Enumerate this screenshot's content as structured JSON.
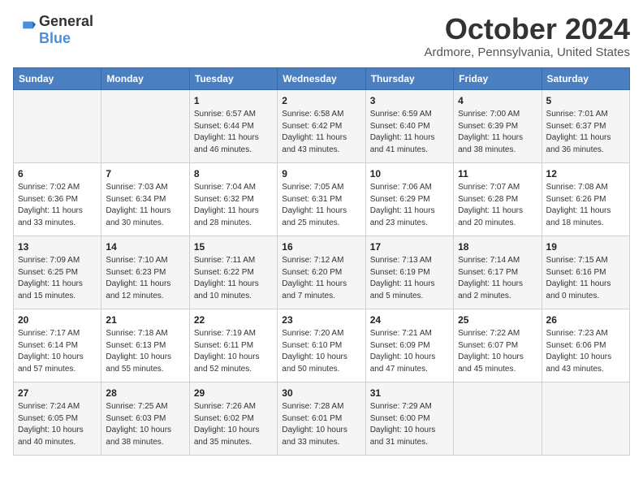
{
  "logo": {
    "general": "General",
    "blue": "Blue"
  },
  "header": {
    "month": "October 2024",
    "location": "Ardmore, Pennsylvania, United States"
  },
  "weekdays": [
    "Sunday",
    "Monday",
    "Tuesday",
    "Wednesday",
    "Thursday",
    "Friday",
    "Saturday"
  ],
  "weeks": [
    [
      {
        "day": "",
        "info": ""
      },
      {
        "day": "",
        "info": ""
      },
      {
        "day": "1",
        "info": "Sunrise: 6:57 AM\nSunset: 6:44 PM\nDaylight: 11 hours and 46 minutes."
      },
      {
        "day": "2",
        "info": "Sunrise: 6:58 AM\nSunset: 6:42 PM\nDaylight: 11 hours and 43 minutes."
      },
      {
        "day": "3",
        "info": "Sunrise: 6:59 AM\nSunset: 6:40 PM\nDaylight: 11 hours and 41 minutes."
      },
      {
        "day": "4",
        "info": "Sunrise: 7:00 AM\nSunset: 6:39 PM\nDaylight: 11 hours and 38 minutes."
      },
      {
        "day": "5",
        "info": "Sunrise: 7:01 AM\nSunset: 6:37 PM\nDaylight: 11 hours and 36 minutes."
      }
    ],
    [
      {
        "day": "6",
        "info": "Sunrise: 7:02 AM\nSunset: 6:36 PM\nDaylight: 11 hours and 33 minutes."
      },
      {
        "day": "7",
        "info": "Sunrise: 7:03 AM\nSunset: 6:34 PM\nDaylight: 11 hours and 30 minutes."
      },
      {
        "day": "8",
        "info": "Sunrise: 7:04 AM\nSunset: 6:32 PM\nDaylight: 11 hours and 28 minutes."
      },
      {
        "day": "9",
        "info": "Sunrise: 7:05 AM\nSunset: 6:31 PM\nDaylight: 11 hours and 25 minutes."
      },
      {
        "day": "10",
        "info": "Sunrise: 7:06 AM\nSunset: 6:29 PM\nDaylight: 11 hours and 23 minutes."
      },
      {
        "day": "11",
        "info": "Sunrise: 7:07 AM\nSunset: 6:28 PM\nDaylight: 11 hours and 20 minutes."
      },
      {
        "day": "12",
        "info": "Sunrise: 7:08 AM\nSunset: 6:26 PM\nDaylight: 11 hours and 18 minutes."
      }
    ],
    [
      {
        "day": "13",
        "info": "Sunrise: 7:09 AM\nSunset: 6:25 PM\nDaylight: 11 hours and 15 minutes."
      },
      {
        "day": "14",
        "info": "Sunrise: 7:10 AM\nSunset: 6:23 PM\nDaylight: 11 hours and 12 minutes."
      },
      {
        "day": "15",
        "info": "Sunrise: 7:11 AM\nSunset: 6:22 PM\nDaylight: 11 hours and 10 minutes."
      },
      {
        "day": "16",
        "info": "Sunrise: 7:12 AM\nSunset: 6:20 PM\nDaylight: 11 hours and 7 minutes."
      },
      {
        "day": "17",
        "info": "Sunrise: 7:13 AM\nSunset: 6:19 PM\nDaylight: 11 hours and 5 minutes."
      },
      {
        "day": "18",
        "info": "Sunrise: 7:14 AM\nSunset: 6:17 PM\nDaylight: 11 hours and 2 minutes."
      },
      {
        "day": "19",
        "info": "Sunrise: 7:15 AM\nSunset: 6:16 PM\nDaylight: 11 hours and 0 minutes."
      }
    ],
    [
      {
        "day": "20",
        "info": "Sunrise: 7:17 AM\nSunset: 6:14 PM\nDaylight: 10 hours and 57 minutes."
      },
      {
        "day": "21",
        "info": "Sunrise: 7:18 AM\nSunset: 6:13 PM\nDaylight: 10 hours and 55 minutes."
      },
      {
        "day": "22",
        "info": "Sunrise: 7:19 AM\nSunset: 6:11 PM\nDaylight: 10 hours and 52 minutes."
      },
      {
        "day": "23",
        "info": "Sunrise: 7:20 AM\nSunset: 6:10 PM\nDaylight: 10 hours and 50 minutes."
      },
      {
        "day": "24",
        "info": "Sunrise: 7:21 AM\nSunset: 6:09 PM\nDaylight: 10 hours and 47 minutes."
      },
      {
        "day": "25",
        "info": "Sunrise: 7:22 AM\nSunset: 6:07 PM\nDaylight: 10 hours and 45 minutes."
      },
      {
        "day": "26",
        "info": "Sunrise: 7:23 AM\nSunset: 6:06 PM\nDaylight: 10 hours and 43 minutes."
      }
    ],
    [
      {
        "day": "27",
        "info": "Sunrise: 7:24 AM\nSunset: 6:05 PM\nDaylight: 10 hours and 40 minutes."
      },
      {
        "day": "28",
        "info": "Sunrise: 7:25 AM\nSunset: 6:03 PM\nDaylight: 10 hours and 38 minutes."
      },
      {
        "day": "29",
        "info": "Sunrise: 7:26 AM\nSunset: 6:02 PM\nDaylight: 10 hours and 35 minutes."
      },
      {
        "day": "30",
        "info": "Sunrise: 7:28 AM\nSunset: 6:01 PM\nDaylight: 10 hours and 33 minutes."
      },
      {
        "day": "31",
        "info": "Sunrise: 7:29 AM\nSunset: 6:00 PM\nDaylight: 10 hours and 31 minutes."
      },
      {
        "day": "",
        "info": ""
      },
      {
        "day": "",
        "info": ""
      }
    ]
  ]
}
